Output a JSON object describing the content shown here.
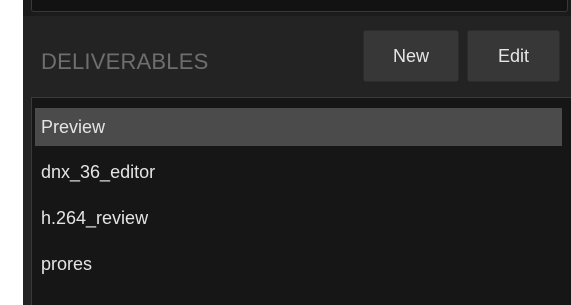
{
  "deliverables": {
    "title": "DELIVERABLES",
    "new_label": "New",
    "edit_label": "Edit",
    "items": [
      {
        "label": "Preview",
        "selected": true
      },
      {
        "label": "dnx_36_editor",
        "selected": false
      },
      {
        "label": "h.264_review",
        "selected": false
      },
      {
        "label": "prores",
        "selected": false
      }
    ]
  },
  "colors": {
    "panel_background": "#232323",
    "list_background": "#161616",
    "selection": "#4b4b4b",
    "button": "#373737",
    "title_text": "#6e6e6e",
    "item_text": "#e4e4e4"
  }
}
